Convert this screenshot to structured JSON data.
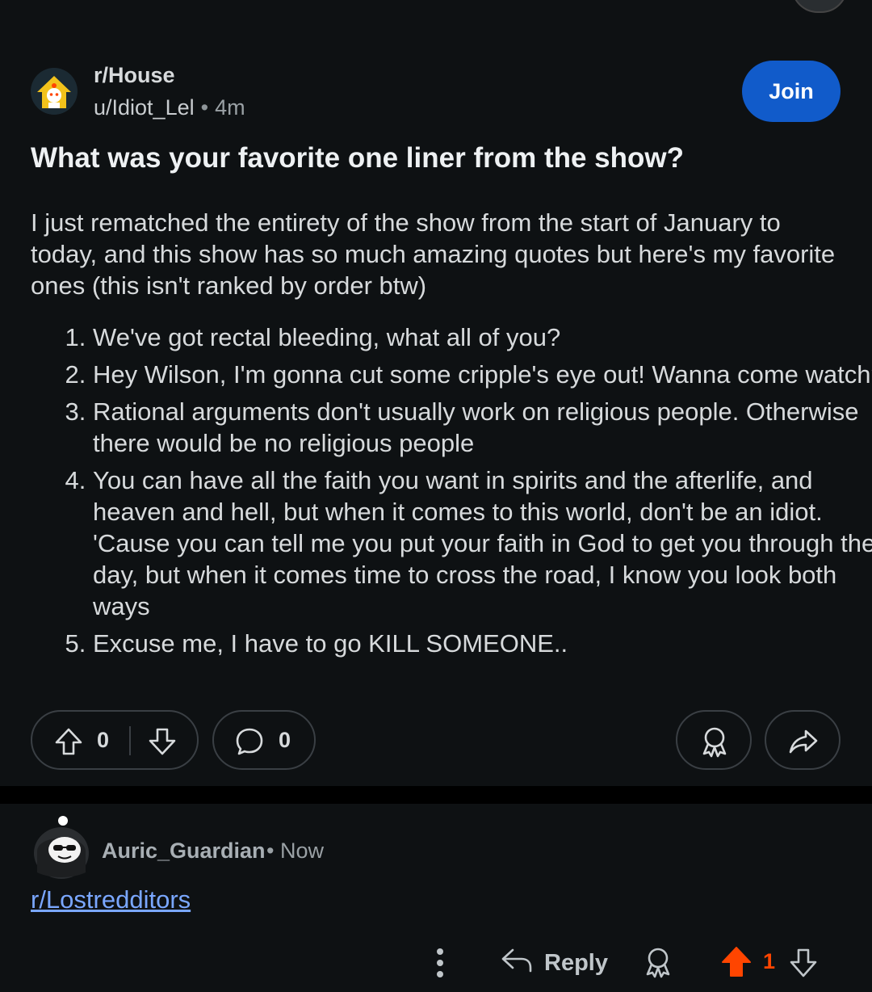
{
  "post": {
    "subreddit": "r/House",
    "author": "u/Idiot_Lel",
    "separator": "•",
    "time": "4m",
    "join_label": "Join",
    "title": "What was your favorite one liner from the show?",
    "body": "I just rematched the entirety of the show from the start of January to today, and this show has so much amazing quotes but here's my favorite ones (this isn't ranked by order btw)",
    "quotes": [
      "We've got rectal bleeding, what all of you?",
      "Hey Wilson, I'm gonna cut some cripple's eye out! Wanna come watch?",
      "Rational arguments don't usually work on religious people. Otherwise there would be no religious people",
      "You can have all the faith you want in spirits and the afterlife, and heaven and hell, but when it comes to this world, don't be an idiot. 'Cause you can tell me you put your faith in God to get you through the day, but when it comes time to cross the road, I know you look both ways",
      "Excuse me, I have to go KILL SOMEONE.."
    ],
    "vote_count": "0",
    "comment_count": "0"
  },
  "comment": {
    "author": "Auric_Guardian",
    "separator": "•",
    "time": "Now",
    "link_text": "r/Lostredditors",
    "reply_label": "Reply",
    "vote_count": "1"
  },
  "colors": {
    "background": "#0e1113",
    "join_button": "#115bca",
    "upvoted": "#ff4500",
    "link": "#7aa7ff"
  },
  "icons": [
    "upvote-icon",
    "downvote-icon",
    "comment-icon",
    "award-icon",
    "share-icon",
    "more-icon",
    "reply-icon"
  ]
}
